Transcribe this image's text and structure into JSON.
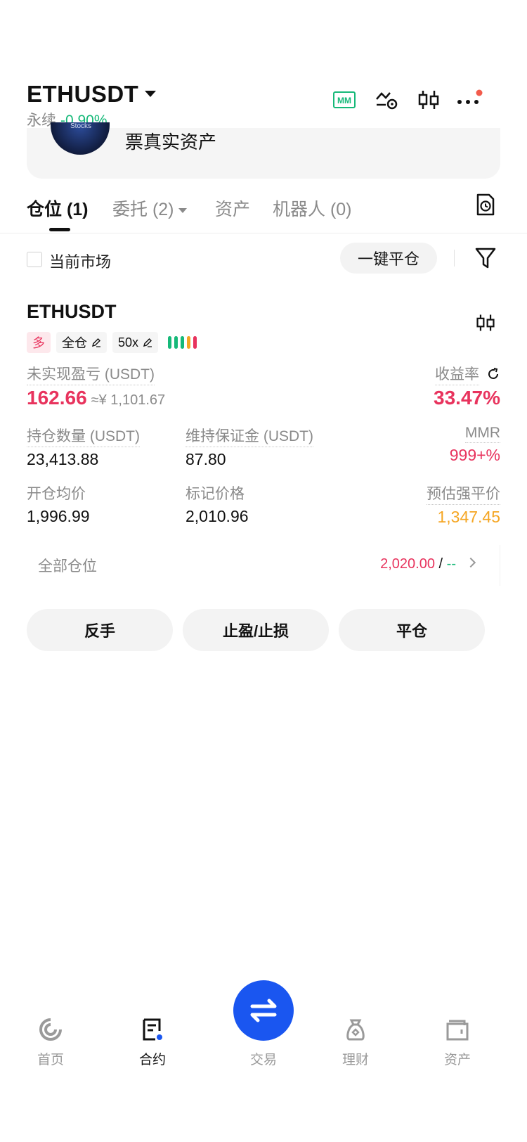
{
  "header": {
    "pair": "ETHUSDT",
    "contract_type": "永续",
    "change_pct": "-0.90%",
    "icons": [
      "mm-icon",
      "strategy-icon",
      "candlestick-icon",
      "more-icon"
    ]
  },
  "banner": {
    "avatar_text": "Stocks",
    "text": "票真实资产"
  },
  "tabs": {
    "positions": "仓位 (1)",
    "orders": "委托 (2)",
    "assets": "资产",
    "bots": "机器人 (0)"
  },
  "filter": {
    "current_market_label": "当前市场",
    "close_all_label": "一键平仓"
  },
  "position": {
    "symbol": "ETHUSDT",
    "side": "多",
    "margin_mode": "全仓",
    "leverage": "50x",
    "risk_colors": [
      "#16b979",
      "#16b979",
      "#16b979",
      "#f5a623",
      "#e8335d"
    ],
    "unrealized_label": "未实现盈亏 (USDT)",
    "unrealized_value": "162.66",
    "unrealized_cny": "≈¥ 1,101.67",
    "roe_label": "收益率",
    "roe_value": "33.47%",
    "size_label": "持仓数量 (USDT)",
    "size_value": "23,413.88",
    "maint_margin_label": "维持保证金 (USDT)",
    "maint_margin_value": "87.80",
    "mmr_label": "MMR",
    "mmr_value": "999+%",
    "entry_label": "开仓均价",
    "entry_value": "1,996.99",
    "mark_label": "标记价格",
    "mark_value": "2,010.96",
    "liq_label": "预估强平价",
    "liq_value": "1,347.45"
  },
  "all_positions": {
    "label": "全部仓位",
    "tp_value": "2,020.00",
    "separator": "/",
    "sl_value": "--"
  },
  "actions": {
    "reverse": "反手",
    "tpsl": "止盈/止损",
    "close": "平仓"
  },
  "nav": {
    "home": "首页",
    "futures": "合约",
    "trade": "交易",
    "earn": "理财",
    "assets": "资产"
  },
  "colors": {
    "green": "#16b979",
    "red": "#e8335d",
    "orange": "#f5a623",
    "blue": "#1a56f0"
  }
}
